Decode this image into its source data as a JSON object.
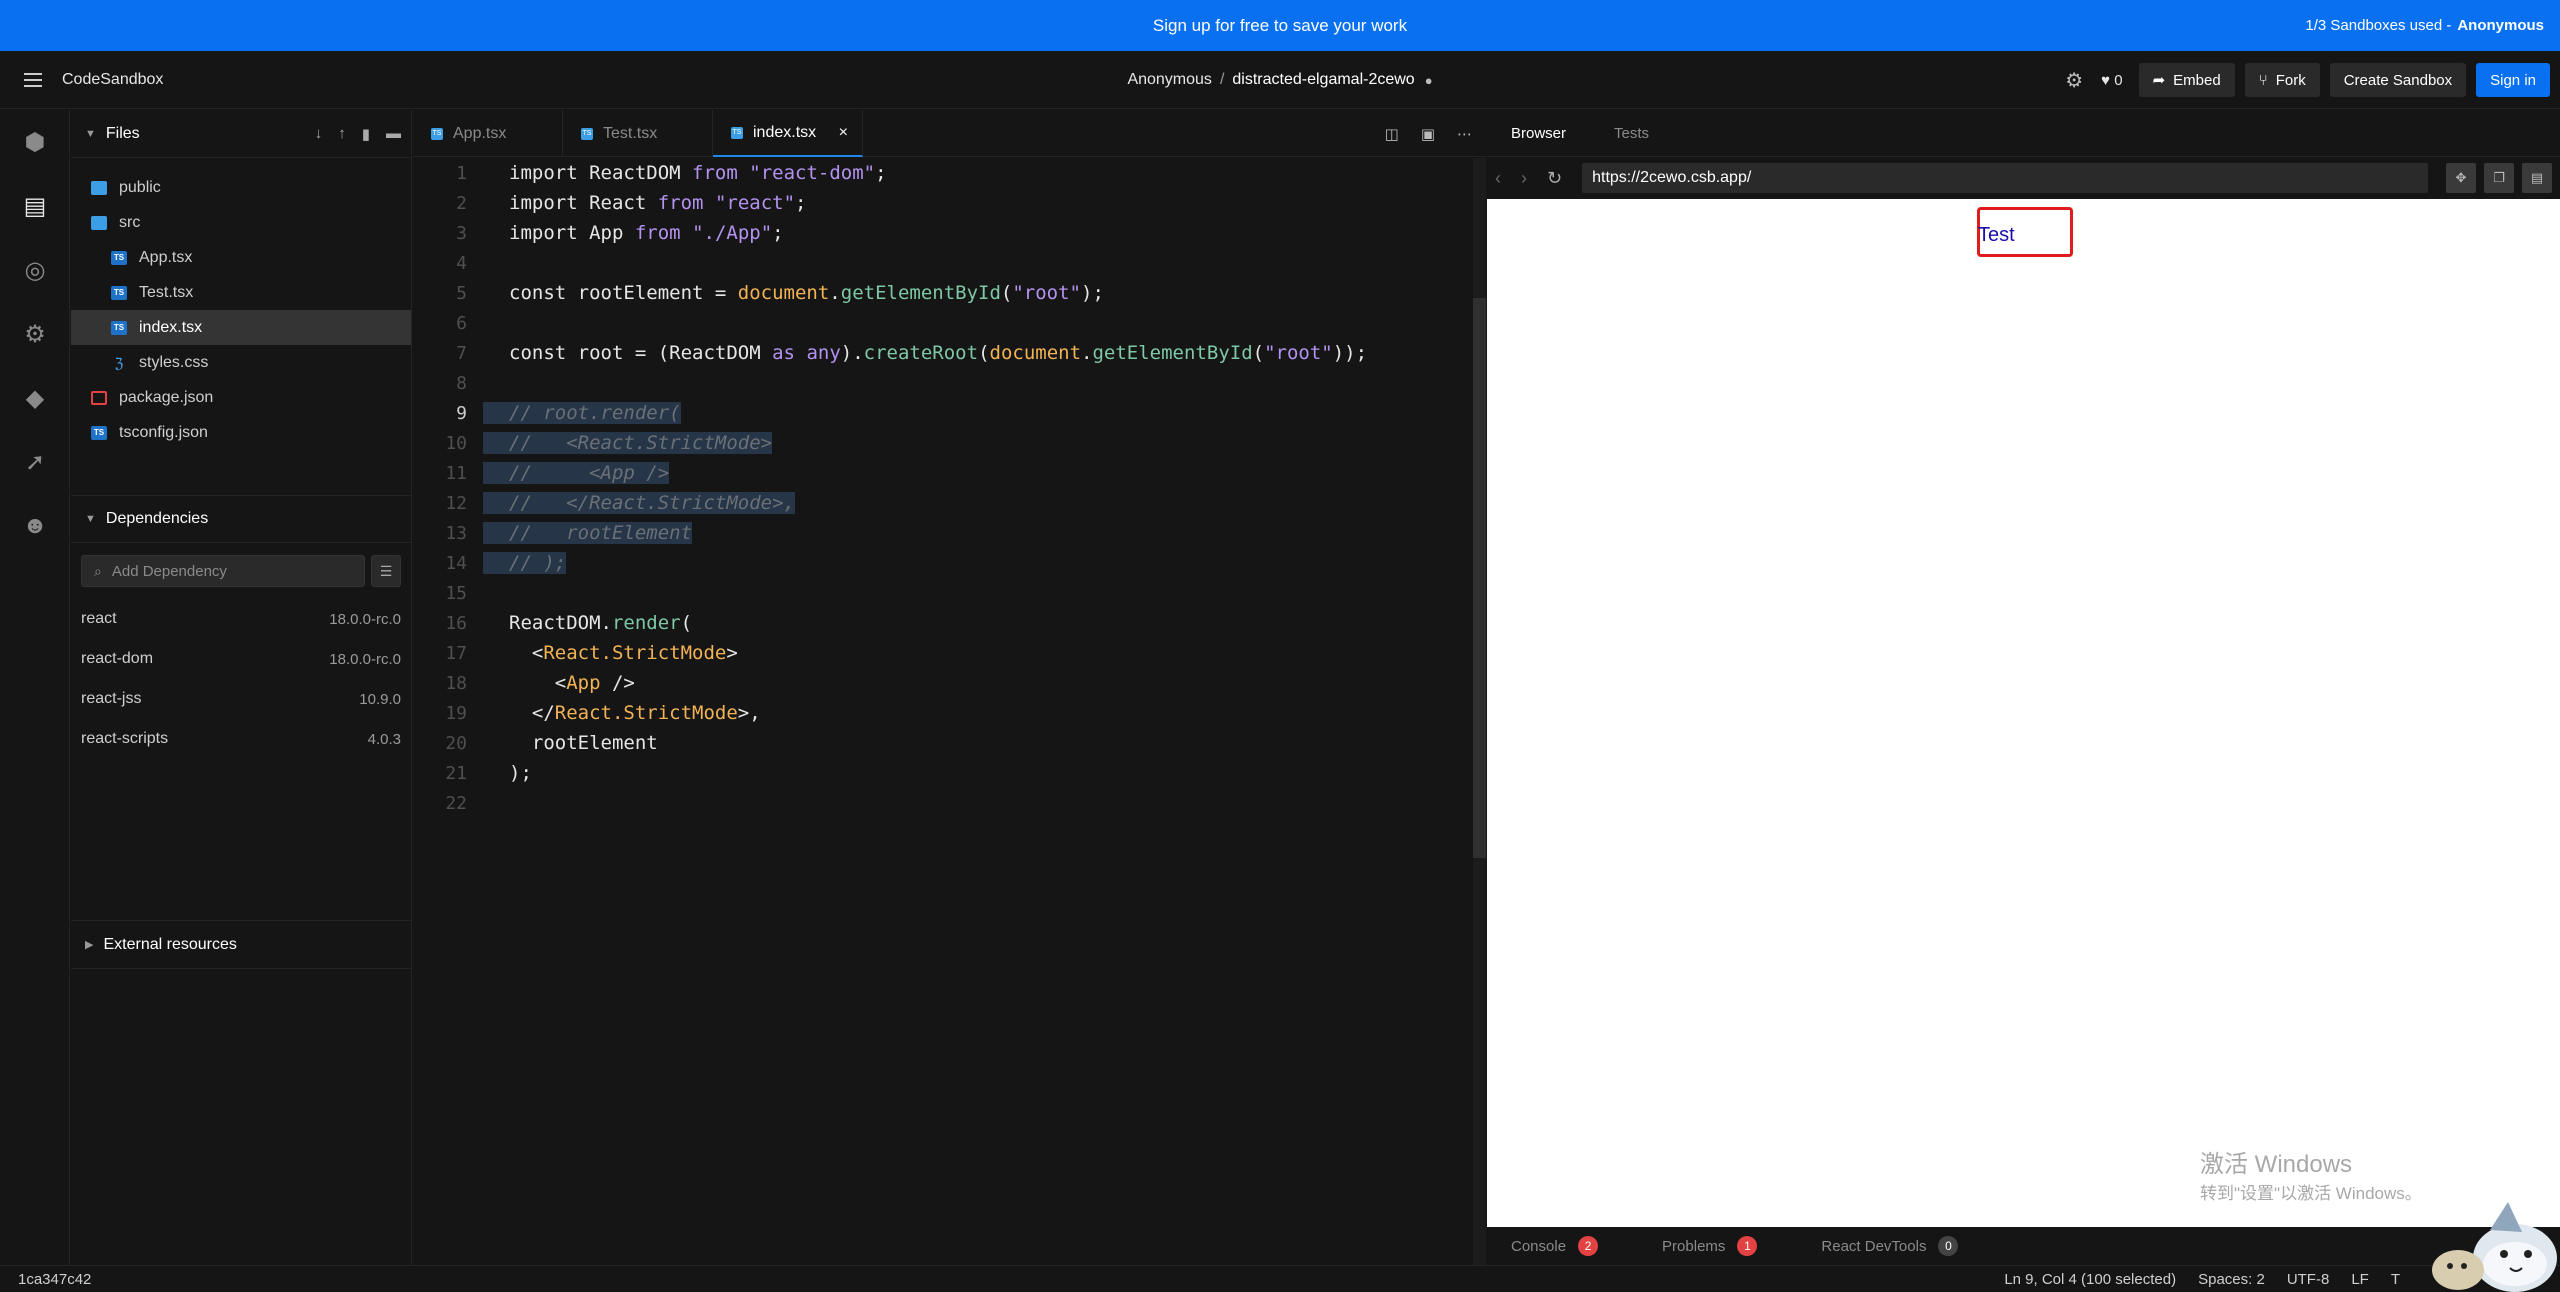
{
  "banner": {
    "message": "Sign up for free to save your work",
    "usage": "1/3 Sandboxes used -",
    "user": "Anonymous"
  },
  "header": {
    "brand": "CodeSandbox",
    "owner": "Anonymous",
    "separator": "/",
    "sandbox_name": "distracted-elgamal-2cewo",
    "likes": "0",
    "embed": "Embed",
    "fork": "Fork",
    "create": "Create Sandbox",
    "signin": "Sign in"
  },
  "sidebar": {
    "files_title": "Files",
    "tree": [
      {
        "label": "public",
        "type": "folder",
        "indent": 0
      },
      {
        "label": "src",
        "type": "folder-open",
        "indent": 0
      },
      {
        "label": "App.tsx",
        "type": "ts",
        "indent": 1
      },
      {
        "label": "Test.tsx",
        "type": "ts",
        "indent": 1
      },
      {
        "label": "index.tsx",
        "type": "ts",
        "indent": 1
      },
      {
        "label": "styles.css",
        "type": "css",
        "indent": 1
      },
      {
        "label": "package.json",
        "type": "json",
        "indent": 0
      },
      {
        "label": "tsconfig.json",
        "type": "json-ts",
        "indent": 0
      }
    ],
    "deps_title": "Dependencies",
    "add_dep_placeholder": "Add Dependency",
    "deps": [
      {
        "name": "react",
        "version": "18.0.0-rc.0"
      },
      {
        "name": "react-dom",
        "version": "18.0.0-rc.0"
      },
      {
        "name": "react-jss",
        "version": "10.9.0"
      },
      {
        "name": "react-scripts",
        "version": "4.0.3"
      }
    ],
    "external_title": "External resources"
  },
  "editor": {
    "tabs": [
      {
        "label": "App.tsx",
        "active": false
      },
      {
        "label": "Test.tsx",
        "active": false
      },
      {
        "label": "index.tsx",
        "active": true
      }
    ],
    "close_glyph": "×",
    "lines": [
      "import ReactDOM from \"react-dom\";",
      "import React from \"react\";",
      "import App from \"./App\";",
      "",
      "const rootElement = document.getElementById(\"root\");",
      "",
      "const root = (ReactDOM as any).createRoot(document.getElementById(\"root\"));",
      "",
      "// root.render(",
      "//   <React.StrictMode>",
      "//     <App />",
      "//   </React.StrictMode>,",
      "//   rootElement",
      "// );",
      "",
      "ReactDOM.render(",
      "  <React.StrictMode>",
      "    <App />",
      "  </React.StrictMode>,",
      "  rootElement",
      ");",
      ""
    ]
  },
  "preview": {
    "tabs": [
      "Browser",
      "Tests"
    ],
    "url": "https://2cewo.csb.app/",
    "content_link": "Test",
    "watermark_title": "激活 Windows",
    "watermark_sub": "转到\"设置\"以激活 Windows。",
    "dev_tabs": [
      {
        "label": "Console",
        "count": "2",
        "alert": true
      },
      {
        "label": "Problems",
        "count": "1",
        "alert": true
      },
      {
        "label": "React DevTools",
        "count": "0",
        "alert": false
      }
    ]
  },
  "status": {
    "commit": "1ca347c42",
    "cursor": "Ln 9, Col 4 (100 selected)",
    "spaces": "Spaces: 2",
    "encoding": "UTF-8",
    "eol": "LF",
    "lang": "T"
  }
}
